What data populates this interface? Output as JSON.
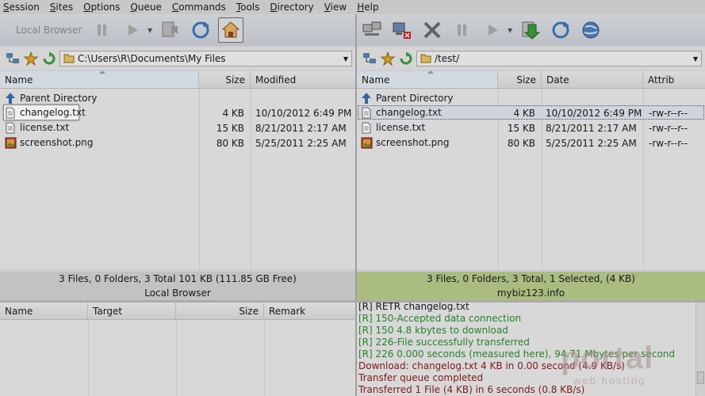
{
  "menu": [
    "Session",
    "Sites",
    "Options",
    "Queue",
    "Commands",
    "Tools",
    "Directory",
    "View",
    "Help"
  ],
  "toolbar_left": {
    "local_browser_label": "Local Browser"
  },
  "local": {
    "path": "C:\\Users\\R\\Documents\\My Files",
    "columns": [
      "Name",
      "Size",
      "Modified"
    ],
    "parent": "Parent Directory",
    "files": [
      {
        "name": "changelog.txt",
        "size": "4 KB",
        "modified": "10/10/2012 6:49 PM"
      },
      {
        "name": "license.txt",
        "size": "15 KB",
        "modified": "8/21/2011 2:17 AM"
      },
      {
        "name": "screenshot.png",
        "size": "80 KB",
        "modified": "5/25/2011 2:25 AM"
      }
    ],
    "status": "3 Files, 0 Folders, 3 Total 101 KB (111.85 GB Free)",
    "label": "Local Browser"
  },
  "remote": {
    "path": "/test/",
    "columns": [
      "Name",
      "Size",
      "Date",
      "Attrib"
    ],
    "parent": "Parent Directory",
    "files": [
      {
        "name": "changelog.txt",
        "size": "4 KB",
        "date": "10/10/2012 6:49 PM",
        "attrib": "-rw-r--r--"
      },
      {
        "name": "license.txt",
        "size": "15 KB",
        "date": "8/21/2011 2:17 AM",
        "attrib": "-rw-r--r--"
      },
      {
        "name": "screenshot.png",
        "size": "80 KB",
        "date": "5/25/2011 2:25 AM",
        "attrib": "-rw-r--r--"
      }
    ],
    "status": "3 Files, 0 Folders, 3 Total, 1 Selected, (4 KB)",
    "label": "mybiz123.info"
  },
  "queue": {
    "columns": [
      "Name",
      "Target",
      "Size",
      "Remark"
    ]
  },
  "log": [
    {
      "text": "[R] RETR changelog.txt",
      "color": "#1a1a1a"
    },
    {
      "text": "[R] 150-Accepted data connection",
      "color": "#2a8a2a"
    },
    {
      "text": "[R] 150 4.8 kbytes to download",
      "color": "#2a8a2a"
    },
    {
      "text": "[R] 226-File successfully transferred",
      "color": "#2a8a2a"
    },
    {
      "text": "[R] 226 0.000 seconds (measured here), 94.71 Mbytes per second",
      "color": "#2a8a2a"
    },
    {
      "text": "Download: changelog.txt 4 KB in 0.00 second (4.9 KB/s)",
      "color": "#8a1a1a"
    },
    {
      "text": "Transfer queue completed",
      "color": "#8a1a1a"
    },
    {
      "text": "Transferred 1 File (4 KB) in 6 seconds (0.8 KB/s)",
      "color": "#8a1a1a"
    }
  ],
  "watermark": {
    "main": "portal",
    "sub": "web hosting"
  }
}
